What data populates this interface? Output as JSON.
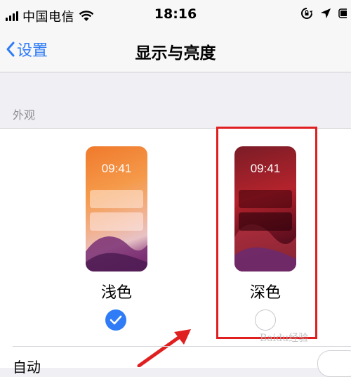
{
  "status_bar": {
    "carrier": "中国电信",
    "time": "18:16"
  },
  "nav": {
    "back_label": "设置",
    "title": "显示与亮度"
  },
  "appearance": {
    "section_label": "外观",
    "options": [
      {
        "label": "浅色",
        "time": "09:41",
        "selected": true
      },
      {
        "label": "深色",
        "time": "09:41",
        "selected": false
      }
    ]
  },
  "automatic": {
    "label": "自动"
  },
  "watermark": "Baidu经验",
  "colors": {
    "accent": "#2f7cf6",
    "highlight_box": "#e02020",
    "background": "#efeff4"
  },
  "icons": [
    "signal-icon",
    "wifi-icon",
    "rotation-lock-icon",
    "location-icon",
    "back-chevron-icon",
    "checkmark-icon",
    "red-arrow-icon"
  ]
}
